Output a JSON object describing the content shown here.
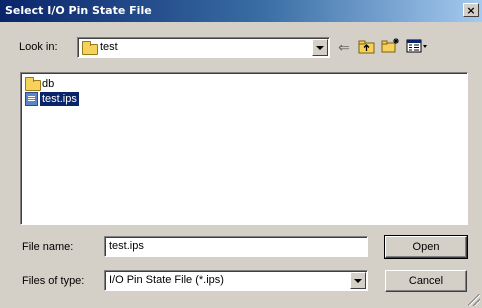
{
  "window": {
    "title": "Select I/O Pin State File",
    "close_glyph": "×"
  },
  "toolbar": {
    "look_in_label": "Look in:",
    "look_in_value": "test",
    "icons": [
      "back-arrow-icon",
      "up-folder-icon",
      "new-folder-icon",
      "view-menu-icon"
    ]
  },
  "file_list": [
    {
      "name": "db",
      "type": "folder",
      "selected": false
    },
    {
      "name": "test.ips",
      "type": "file",
      "selected": true
    }
  ],
  "file_name": {
    "label": "File name:",
    "value": "test.ips"
  },
  "files_of_type": {
    "label": "Files of type:",
    "value": "I/O Pin State File (*.ips)"
  },
  "buttons": {
    "open": "Open",
    "cancel": "Cancel"
  },
  "colors": {
    "titlebar_start": "#0a246a",
    "titlebar_end": "#a6caf0",
    "face": "#d4d0c8",
    "selection": "#0a246a"
  }
}
